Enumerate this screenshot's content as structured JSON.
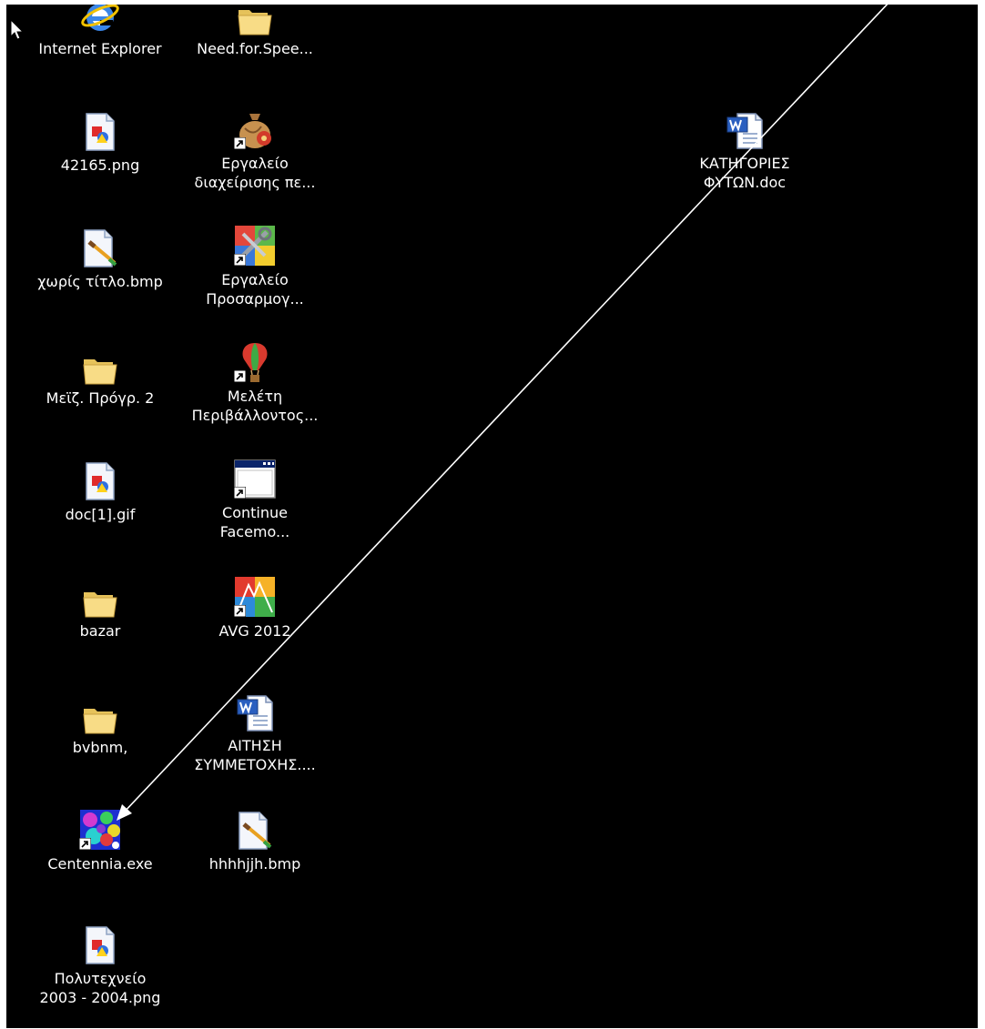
{
  "desktop": {
    "background": "#000000",
    "label_color": "#ffffff",
    "icons": [
      {
        "label": "Internet Explorer",
        "icon": "internet-explorer-icon"
      },
      {
        "label": "Need.for.Spee...",
        "icon": "folder-icon"
      },
      {
        "label": "42165.png",
        "icon": "image-file-icon"
      },
      {
        "label": "Εργαλείο\nδιαχείρισης πε...",
        "icon": "money-bag-icon",
        "shortcut": true
      },
      {
        "label": "ΚΑΤΗΓΟΡΙΕΣ\nΦΥΤΩΝ.doc",
        "icon": "word-document-icon"
      },
      {
        "label": "χωρίς τίτλο.bmp",
        "icon": "paint-file-icon"
      },
      {
        "label": "Εργαλείο\nΠροσαρμογ...",
        "icon": "tools-icon",
        "shortcut": true
      },
      {
        "label": "Μεϊζ. Πρόγρ. 2",
        "icon": "folder-icon"
      },
      {
        "label": "Μελέτη\nΠεριβάλλοντος...",
        "icon": "hot-air-balloon-icon",
        "shortcut": true
      },
      {
        "label": "doc[1].gif",
        "icon": "image-file-icon"
      },
      {
        "label": "Continue\nFacemo...",
        "icon": "window-app-icon",
        "shortcut": true
      },
      {
        "label": "bazar",
        "icon": "folder-icon"
      },
      {
        "label": "AVG 2012",
        "icon": "avg-antivirus-icon",
        "shortcut": true
      },
      {
        "label": "bvbnm,",
        "icon": "folder-icon"
      },
      {
        "label": "ΑΙΤΗΣΗ\nΣΥΜΜΕΤΟΧΗΣ....",
        "icon": "word-document-icon"
      },
      {
        "label": "Centennia.exe",
        "icon": "centennia-map-icon",
        "shortcut": true
      },
      {
        "label": "hhhhjjh.bmp",
        "icon": "paint-file-icon"
      },
      {
        "label": "Πολυτεχνείο\n2003 - 2004.png",
        "icon": "image-file-icon"
      }
    ]
  }
}
